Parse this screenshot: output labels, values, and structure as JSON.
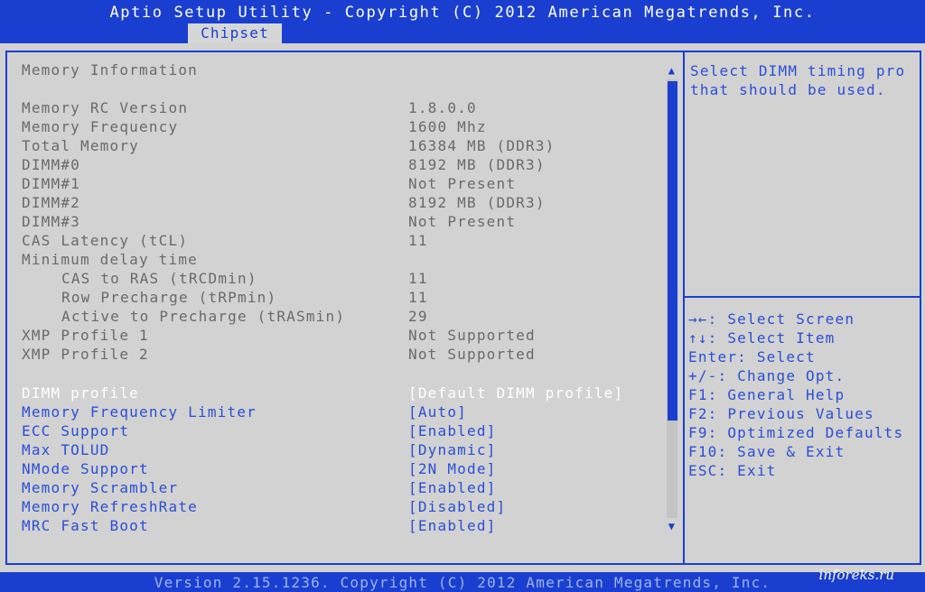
{
  "header": {
    "title": "Aptio Setup Utility - Copyright (C) 2012 American Megatrends, Inc.",
    "active_tab": "Chipset"
  },
  "info": {
    "section_title": "Memory Information",
    "rows": [
      {
        "label": "Memory RC Version",
        "value": "1.8.0.0"
      },
      {
        "label": "Memory Frequency",
        "value": "1600 Mhz"
      },
      {
        "label": "Total Memory",
        "value": "16384 MB (DDR3)"
      },
      {
        "label": "DIMM#0",
        "value": "8192 MB (DDR3)"
      },
      {
        "label": "DIMM#1",
        "value": "Not Present"
      },
      {
        "label": "DIMM#2",
        "value": "8192 MB (DDR3)"
      },
      {
        "label": "DIMM#3",
        "value": "Not Present"
      },
      {
        "label": "CAS Latency (tCL)",
        "value": "11"
      },
      {
        "label": "Minimum delay time",
        "value": ""
      },
      {
        "label": "CAS to RAS (tRCDmin)",
        "value": "11"
      },
      {
        "label": "Row Precharge (tRPmin)",
        "value": "11"
      },
      {
        "label": "Active to Precharge (tRASmin)",
        "value": "29"
      },
      {
        "label": "XMP Profile 1",
        "value": "Not Supported"
      },
      {
        "label": "XMP Profile 2",
        "value": "Not Supported"
      }
    ]
  },
  "options": [
    {
      "label": "DIMM profile",
      "value": "[Default DIMM profile]"
    },
    {
      "label": "Memory Frequency Limiter",
      "value": "[Auto]"
    },
    {
      "label": "ECC Support",
      "value": "[Enabled]"
    },
    {
      "label": "Max TOLUD",
      "value": "[Dynamic]"
    },
    {
      "label": "NMode Support",
      "value": "[2N Mode]"
    },
    {
      "label": "Memory Scrambler",
      "value": "[Enabled]"
    },
    {
      "label": "Memory RefreshRate",
      "value": "[Disabled]"
    },
    {
      "label": "MRC Fast Boot",
      "value": "[Enabled]"
    }
  ],
  "help": {
    "line1": "Select DIMM timing pro",
    "line2": "that should be used."
  },
  "keys": [
    "→←: Select Screen",
    "↑↓: Select Item",
    "Enter: Select",
    "+/-: Change Opt.",
    "F1: General Help",
    "F2: Previous Values",
    "F9: Optimized Defaults",
    "F10: Save & Exit",
    "ESC: Exit"
  ],
  "footer": {
    "text": "Version 2.15.1236. Copyright (C) 2012 American Megatrends, Inc."
  },
  "watermark": "inforeks.ru",
  "colors": {
    "background": "#d2d2d2",
    "accent_blue": "#1a3fd0",
    "text_gray": "#6a6a6a",
    "text_blue": "#2a4fd6",
    "selected": "#ffffff"
  }
}
